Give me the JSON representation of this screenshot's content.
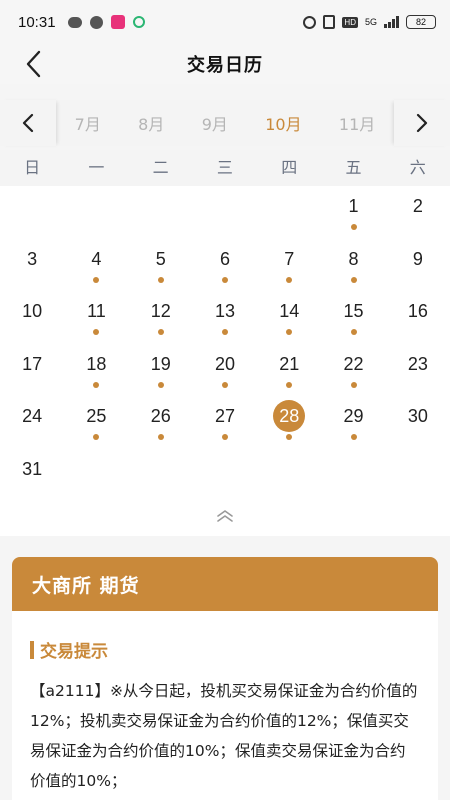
{
  "status_bar": {
    "time": "10:31",
    "network": "5G",
    "hd": "HD",
    "battery": "82"
  },
  "nav": {
    "title": "交易日历"
  },
  "months": [
    "7月",
    "8月",
    "9月",
    "10月",
    "11月"
  ],
  "active_month": "10月",
  "weekdays": [
    "日",
    "一",
    "二",
    "三",
    "四",
    "五",
    "六"
  ],
  "calendar": {
    "selected_day": "28",
    "days": [
      {
        "day": "1",
        "col": 5,
        "row": 0,
        "trading": true
      },
      {
        "day": "2",
        "col": 6,
        "row": 0,
        "trading": false
      },
      {
        "day": "3",
        "col": 0,
        "row": 1,
        "trading": false
      },
      {
        "day": "4",
        "col": 1,
        "row": 1,
        "trading": true
      },
      {
        "day": "5",
        "col": 2,
        "row": 1,
        "trading": true
      },
      {
        "day": "6",
        "col": 3,
        "row": 1,
        "trading": true
      },
      {
        "day": "7",
        "col": 4,
        "row": 1,
        "trading": true
      },
      {
        "day": "8",
        "col": 5,
        "row": 1,
        "trading": true
      },
      {
        "day": "9",
        "col": 6,
        "row": 1,
        "trading": false
      },
      {
        "day": "10",
        "col": 0,
        "row": 2,
        "trading": false
      },
      {
        "day": "11",
        "col": 1,
        "row": 2,
        "trading": true
      },
      {
        "day": "12",
        "col": 2,
        "row": 2,
        "trading": true
      },
      {
        "day": "13",
        "col": 3,
        "row": 2,
        "trading": true
      },
      {
        "day": "14",
        "col": 4,
        "row": 2,
        "trading": true
      },
      {
        "day": "15",
        "col": 5,
        "row": 2,
        "trading": true
      },
      {
        "day": "16",
        "col": 6,
        "row": 2,
        "trading": false
      },
      {
        "day": "17",
        "col": 0,
        "row": 3,
        "trading": false
      },
      {
        "day": "18",
        "col": 1,
        "row": 3,
        "trading": true
      },
      {
        "day": "19",
        "col": 2,
        "row": 3,
        "trading": true
      },
      {
        "day": "20",
        "col": 3,
        "row": 3,
        "trading": true
      },
      {
        "day": "21",
        "col": 4,
        "row": 3,
        "trading": true
      },
      {
        "day": "22",
        "col": 5,
        "row": 3,
        "trading": true
      },
      {
        "day": "23",
        "col": 6,
        "row": 3,
        "trading": false
      },
      {
        "day": "24",
        "col": 0,
        "row": 4,
        "trading": false
      },
      {
        "day": "25",
        "col": 1,
        "row": 4,
        "trading": true
      },
      {
        "day": "26",
        "col": 2,
        "row": 4,
        "trading": true
      },
      {
        "day": "27",
        "col": 3,
        "row": 4,
        "trading": true
      },
      {
        "day": "28",
        "col": 4,
        "row": 4,
        "trading": true
      },
      {
        "day": "29",
        "col": 5,
        "row": 4,
        "trading": true
      },
      {
        "day": "30",
        "col": 6,
        "row": 4,
        "trading": false
      },
      {
        "day": "31",
        "col": 0,
        "row": 5,
        "trading": false
      }
    ]
  },
  "info_card": {
    "header": "大商所 期货",
    "tip_title": "交易提示",
    "tip_body": "【a2111】※从今日起，投机买交易保证金为合约价值的12%；投机卖交易保证金为合约价值的12%；保值买交易保证金为合约价值的10%；保值卖交易保证金为合约价值的10%；"
  },
  "colors": {
    "accent": "#c9893a",
    "weekday": "#6a7282",
    "inactive_month": "#b5b5b5"
  }
}
